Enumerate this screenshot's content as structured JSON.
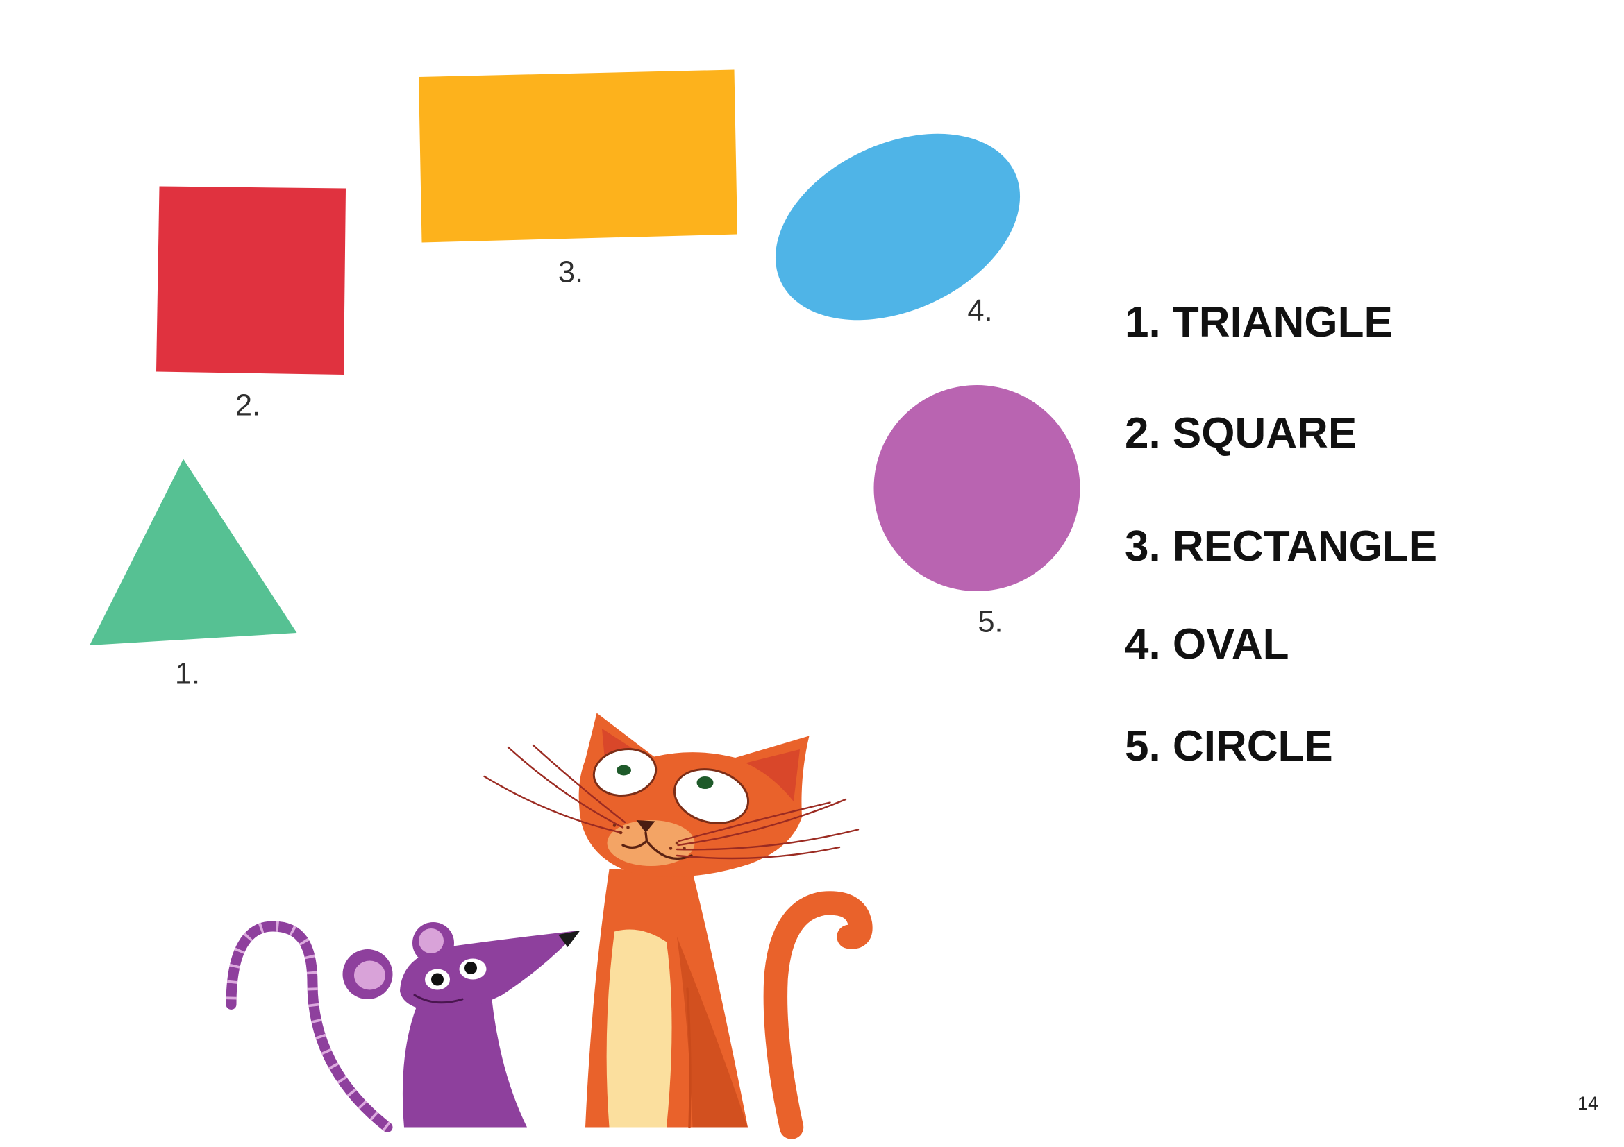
{
  "page_number": "14",
  "shapes": [
    {
      "label": "1.",
      "color": "#56c193"
    },
    {
      "label": "2.",
      "color": "#e0323f"
    },
    {
      "label": "3.",
      "color": "#fdb21c"
    },
    {
      "label": "4.",
      "color": "#4fb4e7"
    },
    {
      "label": "5.",
      "color": "#b964b1"
    }
  ],
  "answers": [
    "1. TRIANGLE",
    "2. SQUARE",
    "3. RECTANGLE",
    "4. OVAL",
    "5. CIRCLE"
  ],
  "illustration_colors": {
    "cat": "#e9622b",
    "cat_chest": "#fbdf9e",
    "mouse": "#8e409d"
  }
}
